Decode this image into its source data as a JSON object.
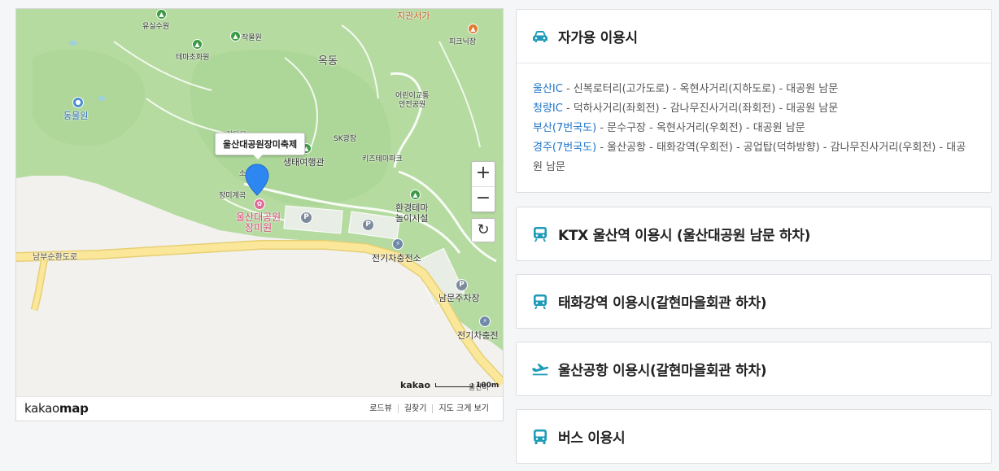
{
  "map": {
    "labels": {
      "yusil": "유실수원",
      "jakmul": "작물원",
      "thema": "테마초화원",
      "okdong": "옥동",
      "jigwan_1": "지관서가",
      "picnic": "피크닉장",
      "zoo": "동물원",
      "child_safety": "어린이교통\n안전공원",
      "sk": "SK광장",
      "kidstheme": "키즈테마파크",
      "eco": "생태여행관",
      "rose_valley": "장미계곡",
      "rose_garden": "울산대공원\n장미원",
      "env_play": "환경테마\n놀이시설",
      "ev_1": "전기차충전소",
      "south_parking": "남문주차장",
      "ev_2": "전기차충전",
      "ring_road": "남부순환도로",
      "partial_1": "장다뮤",
      "partial_2": "소",
      "partial_3": "울산미"
    },
    "info_window": "울산대공원장미축제",
    "zoom_in": "+",
    "zoom_out": "−",
    "refresh": "↻",
    "scale_brand": "kakao",
    "scale_text": "100m",
    "logo_light": "kakao",
    "logo_bold": "map",
    "footer": [
      "로드뷰",
      "길찾기",
      "지도 크게 보기"
    ],
    "colors": {
      "park": "#b5dba0",
      "land": "#f2f1ed",
      "road": "#fbe79a",
      "road_stroke": "#e6cf74",
      "path": "#ffffff"
    }
  },
  "panels": [
    {
      "icon": "car-icon",
      "title": "자가용 이용시",
      "expanded": true,
      "routes": [
        {
          "name": "울산IC",
          "path": " - 신복로터리(고가도로) - 옥현사거리(지하도로) - 대공원 남문"
        },
        {
          "name": "청량IC",
          "path": " - 덕하사거리(좌회전) - 감나무진사거리(좌회전) - 대공원 남문"
        },
        {
          "name": "부산(7번국도)",
          "path": " - 문수구장 - 옥현사거리(우회전) - 대공원 남문"
        },
        {
          "name": "경주(7번국도)",
          "path": " - 울산공항 - 태화강역(우회전) - 공업탑(덕하방향) - 감나무진사거리(우회전) - 대공원 남문"
        }
      ]
    },
    {
      "icon": "train-icon",
      "title": "KTX 울산역 이용시 (울산대공원 남문 하차)"
    },
    {
      "icon": "train-icon",
      "title": "태화강역 이용시(갈현마을회관 하차)"
    },
    {
      "icon": "airplane-icon",
      "title": "울산공항 이용시(갈현마을회관 하차)"
    },
    {
      "icon": "bus-icon",
      "title": "버스 이용시"
    }
  ],
  "accent": "#1e9bb8"
}
